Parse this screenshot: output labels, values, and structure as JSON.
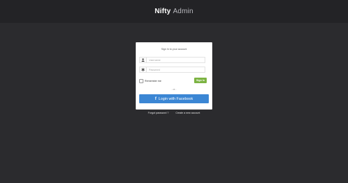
{
  "header": {
    "brand_strong": "Nifty",
    "brand_light": "Admin"
  },
  "login": {
    "title": "Sign In to your account",
    "username_placeholder": "Username",
    "password_placeholder": "Password",
    "username_icon": "user-icon",
    "password_icon": "asterisk-icon",
    "remember_label": "Remember me",
    "remember_checked": false,
    "signin_label": "Sign In",
    "or_label": "- or -",
    "facebook_icon": "facebook-icon",
    "facebook_label": "Login with Facebook"
  },
  "links": {
    "forgot": "Forgot password ?",
    "create": "Create a new account"
  },
  "colors": {
    "background": "#2b2b2e",
    "topbar": "#232326",
    "signin_button": "#7cb342",
    "facebook_button": "#3b86d4"
  }
}
